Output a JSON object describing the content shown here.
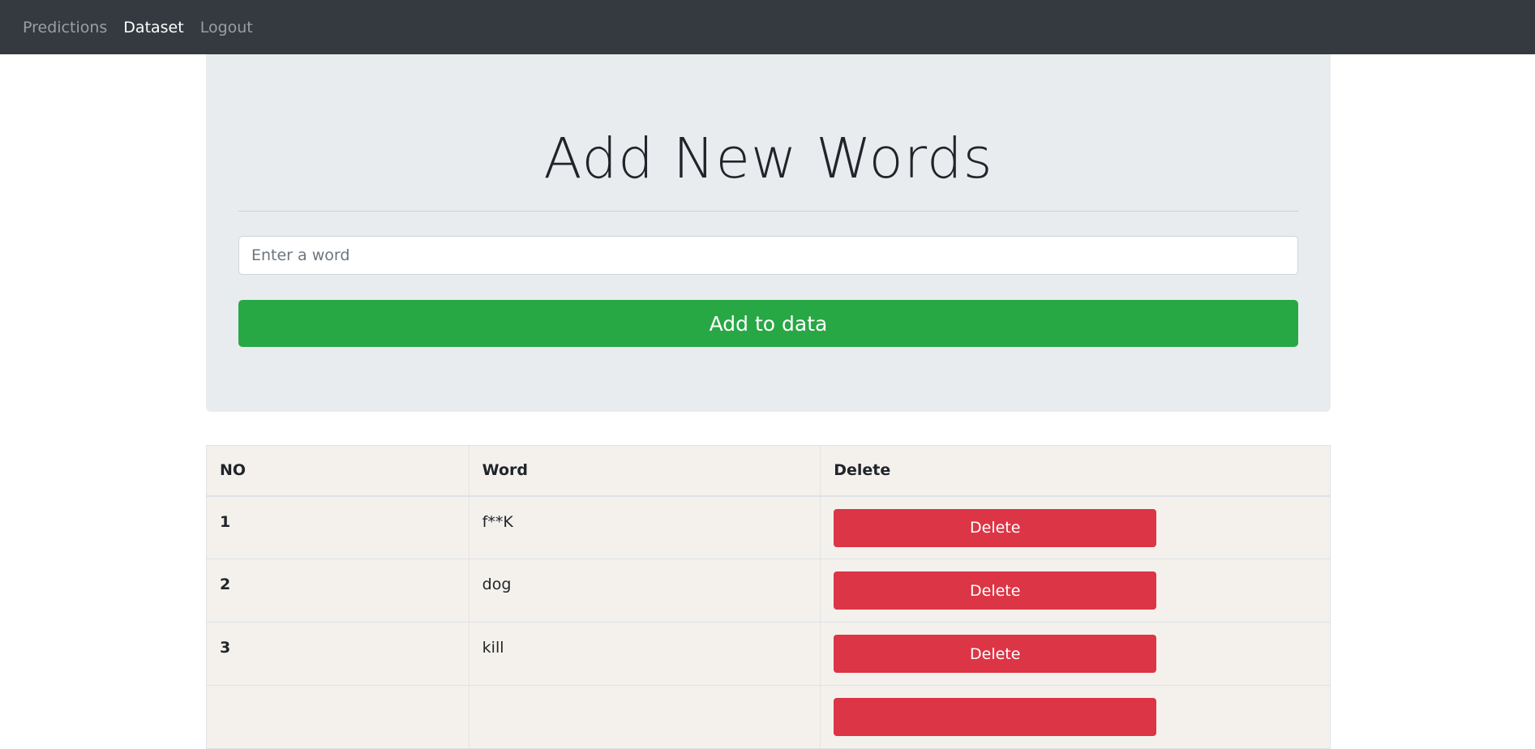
{
  "nav": {
    "items": [
      {
        "label": "Predictions",
        "active": false
      },
      {
        "label": "Dataset",
        "active": true
      },
      {
        "label": "Logout",
        "active": false
      }
    ]
  },
  "jumbotron": {
    "title": "Add New Words",
    "input_placeholder": "Enter a word",
    "input_value": "",
    "add_label": "Add to data"
  },
  "table": {
    "headers": [
      "NO",
      "Word",
      "Delete"
    ],
    "rows": [
      {
        "no": "1",
        "word": "f**K",
        "delete_label": "Delete"
      },
      {
        "no": "2",
        "word": "dog",
        "delete_label": "Delete"
      },
      {
        "no": "3",
        "word": "kill",
        "delete_label": "Delete"
      },
      {
        "no": "",
        "word": "",
        "delete_label": ""
      }
    ]
  },
  "colors": {
    "navbar": "#343a40",
    "jumbotron": "#e9ecef",
    "success": "#28a745",
    "danger": "#dc3545",
    "table_bg": "#f4f1ed"
  }
}
